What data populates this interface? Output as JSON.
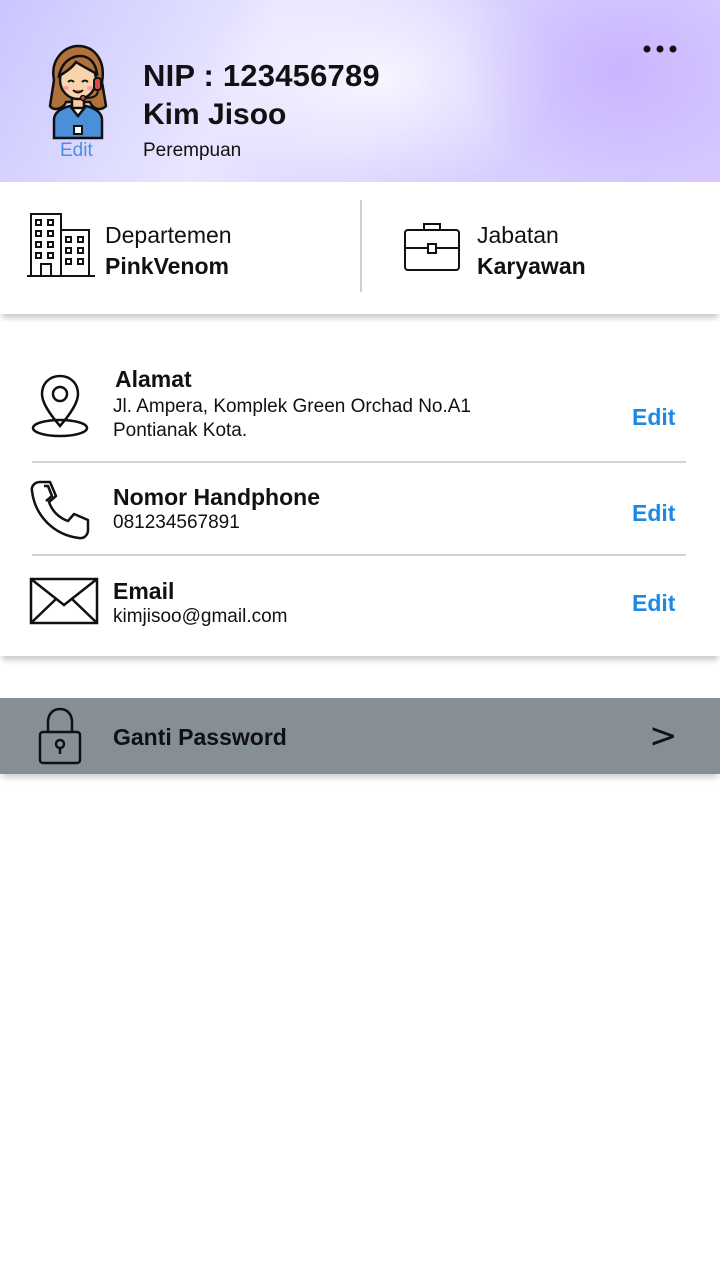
{
  "profile": {
    "nip": "NIP : 123456789",
    "name": "Kim Jisoo",
    "gender": "Perempuan",
    "avatar_edit": "Edit"
  },
  "department": {
    "label": "Departemen",
    "value": "PinkVenom"
  },
  "position": {
    "label": "Jabatan",
    "value": "Karyawan"
  },
  "contacts": [
    {
      "title": "Alamat",
      "lines": [
        "Jl. Ampera, Komplek Green Orchad No.A1",
        "Pontianak Kota."
      ],
      "edit": "Edit",
      "icon": "location-pin-icon"
    },
    {
      "title": "Nomor Handphone",
      "lines": [
        "081234567891"
      ],
      "edit": "Edit",
      "icon": "phone-icon"
    },
    {
      "title": "Email",
      "lines": [
        "kimjisoo@gmail.com"
      ],
      "edit": "Edit",
      "icon": "mail-icon"
    }
  ],
  "password": {
    "label": "Ganti Password",
    "arrow": ">"
  },
  "colors": {
    "accent": "#1e88e5",
    "password_bar": "#868e96",
    "avatar_edit": "#4a90e2"
  }
}
